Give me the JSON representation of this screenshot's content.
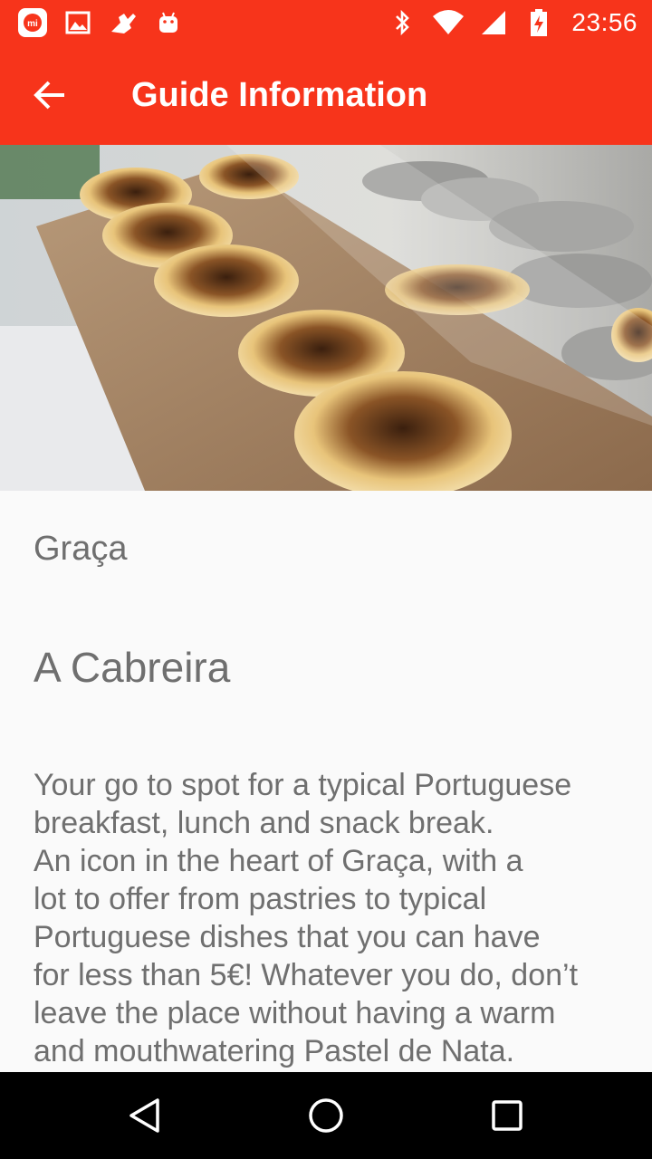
{
  "status_bar": {
    "time": "23:56",
    "left_icons": [
      "mi-app-icon",
      "gallery-icon",
      "hand-icon",
      "android-icon"
    ],
    "right_icons": [
      "bluetooth-icon",
      "wifi-icon",
      "signal-icon",
      "battery-charging-icon"
    ]
  },
  "app_bar": {
    "title": "Guide Information",
    "back_icon": "arrow-back-icon",
    "color": "#f7341b"
  },
  "hero_image": {
    "subject": "pasteis de nata on a wooden tray"
  },
  "guide": {
    "neighbourhood": "Graça",
    "name": "A Cabreira",
    "description": "Your go to spot for a typical Portuguese\nbreakfast, lunch and snack break.\nAn icon in the heart of Graça, with a\nlot to offer from pastries to typical\nPortuguese dishes that you can have\nfor less than 5€! Whatever you do, don’t\nleave the place without having a warm\nand mouthwatering Pastel de Nata."
  },
  "nav_bar": {
    "buttons": [
      "back-triangle-icon",
      "home-circle-icon",
      "recents-square-icon"
    ]
  }
}
